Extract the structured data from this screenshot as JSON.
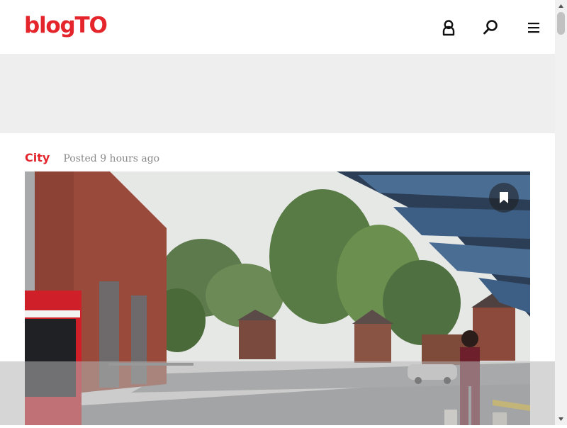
{
  "header": {
    "logo_text": "blogTO",
    "brand_color": "#e4252b",
    "icons": [
      "user-icon",
      "search-icon",
      "menu-icon"
    ]
  },
  "article": {
    "category": "City",
    "posted": "Posted 9 hours ago",
    "hero_image_alt": "",
    "bookmark_icon": "bookmark-icon"
  }
}
